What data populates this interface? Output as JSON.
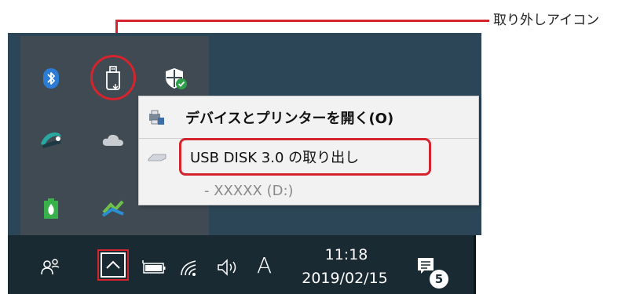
{
  "callout": {
    "label": "取り外しアイコン"
  },
  "tray_overflow": {
    "icons": [
      "bluetooth-icon",
      "usb-drive-icon",
      "windows-security-icon",
      "network-globe-icon",
      "onedrive-icon",
      "battery-leaf-icon",
      "graph-app-icon"
    ]
  },
  "context_menu": {
    "open_devices": "デバイスとプリンターを開く(O)",
    "eject_usb": "USB DISK 3.0 の取り出し",
    "drive_sub": "-   XXXXX (D:)"
  },
  "taskbar": {
    "ime_mode": "A",
    "time": "11:18",
    "date": "2019/02/15",
    "notification_count": "5"
  },
  "colors": {
    "highlight": "#d5242e",
    "taskbar": "#1a2a33",
    "panel": "#3f4a53"
  }
}
